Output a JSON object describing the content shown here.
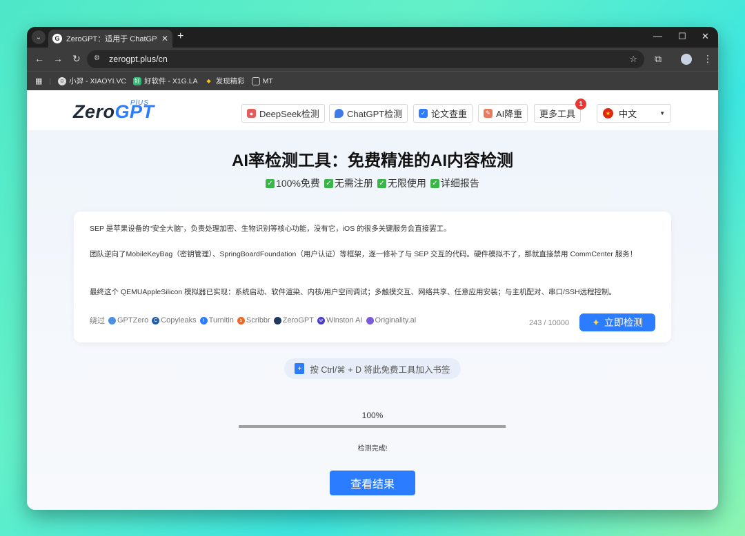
{
  "browser": {
    "tab_title": "ZeroGPT：适用于 ChatGPT、",
    "tab_favicon": "G",
    "url": "zerogpt.plus/cn",
    "bookmarks": [
      {
        "label": "小羿 - XIAOYI.VC",
        "icon": "avatar-icon"
      },
      {
        "label": "好软件 - X1G.LA",
        "icon": "app-icon"
      },
      {
        "label": "发现精彩",
        "icon": "spark-icon"
      },
      {
        "label": "MT",
        "icon": "folder-icon"
      }
    ]
  },
  "site": {
    "logo_main": "Zero",
    "logo_accent": "GPT",
    "logo_plus": "PlUS",
    "nav": [
      {
        "label": "DeepSeek检测",
        "icon": "deepseek-icon"
      },
      {
        "label": "ChatGPT检测",
        "icon": "chatgpt-icon"
      },
      {
        "label": "论文查重",
        "icon": "paper-icon"
      },
      {
        "label": "AI降重",
        "icon": "rewrite-icon"
      },
      {
        "label": "更多工具",
        "icon": "tools-icon",
        "badge": "1"
      }
    ],
    "language": "中文"
  },
  "hero": {
    "title": "AI率检测工具：免费精准的AI内容检测",
    "features": [
      "100%免费",
      "无需注册",
      "无限使用",
      "详细报告"
    ]
  },
  "editor": {
    "paragraphs": [
      "SEP 是苹果设备的“安全大脑”，负责处理加密、生物识别等核心功能，没有它，iOS 的很多关键服务会直接罢工。",
      "团队逆向了MobileKeyBag（密钥管理）、SpringBoardFoundation（用户认证）等框架，逐一修补了与 SEP 交互的代码。硬件模拟不了，那就直接禁用 CommCenter 服务！",
      "最终这个 QEMUAppleSilicon 模拟器已实现：系统启动、软件渲染、内核/用户空间调试；多触摸交互、网络共享、任意应用安装；与主机配对、串口/SSH远程控制。"
    ],
    "bypass_label": "绕过",
    "detectors": [
      {
        "name": "GPTZero",
        "color": "#4a90e2"
      },
      {
        "name": "Copyleaks",
        "color": "#1f5fa8"
      },
      {
        "name": "Turnitin",
        "color": "#2b7cff"
      },
      {
        "name": "Scribbr",
        "color": "#f26522"
      },
      {
        "name": "ZeroGPT",
        "color": "#1e3a5f"
      },
      {
        "name": "Winston AI",
        "color": "#4a3ad6"
      },
      {
        "name": "Originality.ai",
        "color": "#7a5cd6"
      }
    ],
    "char_count": "243 / 10000",
    "detect_button": "立即检测"
  },
  "bookmark_tip": "按 Ctrl/⌘ + D 将此免费工具加入书签",
  "progress": {
    "value": 100,
    "label": "100%",
    "status": "检测完成!"
  },
  "result_button": "查看结果"
}
